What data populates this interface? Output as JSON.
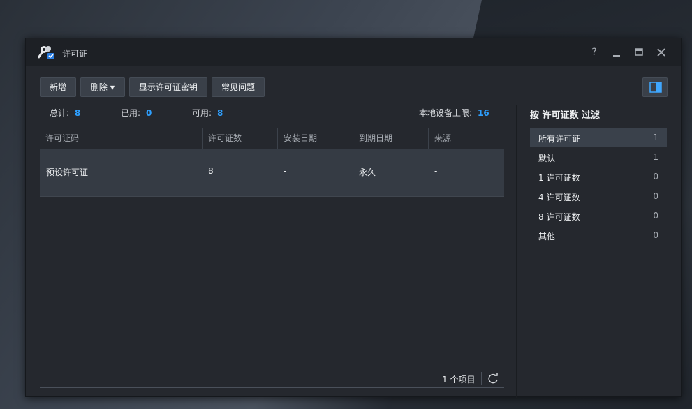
{
  "window": {
    "title": "许可证",
    "help_label": "?",
    "minimize_label": "—",
    "maximize_label": "▣",
    "close_label": "✕"
  },
  "toolbar": {
    "add_label": "新增",
    "delete_label": "删除",
    "show_keys_label": "显示许可证密钥",
    "faq_label": "常见问题"
  },
  "stats": {
    "total_label": "总计:",
    "total_value": "8",
    "used_label": "已用:",
    "used_value": "0",
    "available_label": "可用:",
    "available_value": "8",
    "local_limit_label": "本地设备上限:",
    "local_limit_value": "16"
  },
  "table": {
    "columns": [
      "许可证码",
      "许可证数",
      "安装日期",
      "到期日期",
      "来源"
    ],
    "rows": [
      [
        "预设许可证",
        "8",
        "-",
        "永久",
        "-"
      ]
    ],
    "item_count": "1 个项目"
  },
  "filter": {
    "title": "按 许可证数 过滤",
    "items": [
      {
        "label": "所有许可证",
        "count": "1"
      },
      {
        "label": "默认",
        "count": "1"
      },
      {
        "label": "1 许可证数",
        "count": "0"
      },
      {
        "label": "4 许可证数",
        "count": "0"
      },
      {
        "label": "8 许可证数",
        "count": "0"
      },
      {
        "label": "其他",
        "count": "0"
      }
    ]
  },
  "colors": {
    "accent": "#2ea0ff",
    "window_bg": "#25282e",
    "selected_row": "#353b44"
  },
  "icons": {
    "app": "keys-icon",
    "refresh": "refresh-icon",
    "panel_toggle": "side-panel-icon"
  }
}
